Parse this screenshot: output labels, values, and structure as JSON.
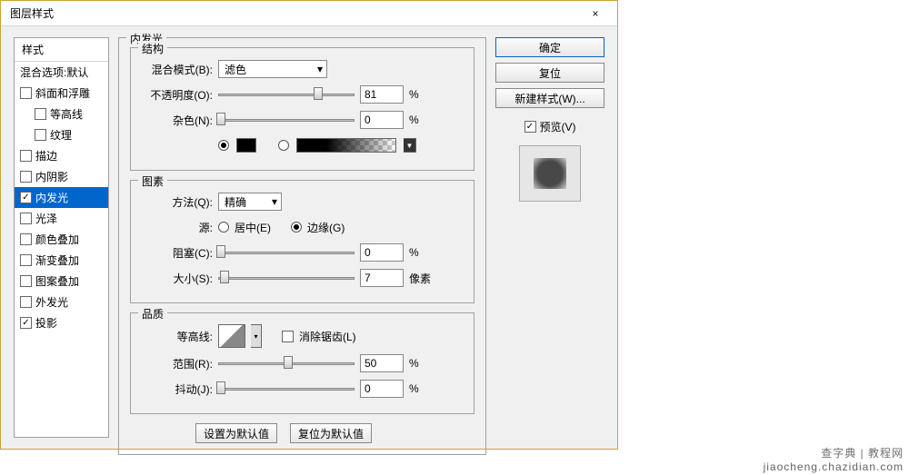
{
  "window": {
    "title": "图层样式",
    "close": "×"
  },
  "sidebar": {
    "header": "样式",
    "blend_options": "混合选项:默认",
    "items": [
      {
        "label": "斜面和浮雕",
        "checked": false,
        "indent": false
      },
      {
        "label": "等高线",
        "checked": false,
        "indent": true
      },
      {
        "label": "纹理",
        "checked": false,
        "indent": true
      },
      {
        "label": "描边",
        "checked": false,
        "indent": false
      },
      {
        "label": "内阴影",
        "checked": false,
        "indent": false
      },
      {
        "label": "内发光",
        "checked": true,
        "indent": false,
        "selected": true
      },
      {
        "label": "光泽",
        "checked": false,
        "indent": false
      },
      {
        "label": "颜色叠加",
        "checked": false,
        "indent": false
      },
      {
        "label": "渐变叠加",
        "checked": false,
        "indent": false
      },
      {
        "label": "图案叠加",
        "checked": false,
        "indent": false
      },
      {
        "label": "外发光",
        "checked": false,
        "indent": false
      },
      {
        "label": "投影",
        "checked": true,
        "indent": false
      }
    ]
  },
  "main": {
    "group_title": "内发光",
    "structure": {
      "title": "结构",
      "blend_mode_label": "混合模式(B):",
      "blend_mode_value": "滤色",
      "opacity_label": "不透明度(O):",
      "opacity_value": "81",
      "opacity_unit": "%",
      "noise_label": "杂色(N):",
      "noise_value": "0",
      "noise_unit": "%"
    },
    "elements": {
      "title": "图素",
      "technique_label": "方法(Q):",
      "technique_value": "精确",
      "source_label": "源:",
      "source_center": "居中(E)",
      "source_edge": "边缘(G)",
      "source_selected": "edge",
      "choke_label": "阻塞(C):",
      "choke_value": "0",
      "choke_unit": "%",
      "size_label": "大小(S):",
      "size_value": "7",
      "size_unit": "像素"
    },
    "quality": {
      "title": "品质",
      "contour_label": "等高线:",
      "antialias_label": "消除锯齿(L)",
      "antialias_checked": false,
      "range_label": "范围(R):",
      "range_value": "50",
      "range_unit": "%",
      "jitter_label": "抖动(J):",
      "jitter_value": "0",
      "jitter_unit": "%"
    },
    "buttons": {
      "make_default": "设置为默认值",
      "reset_default": "复位为默认值"
    }
  },
  "right": {
    "ok": "确定",
    "cancel": "复位",
    "new_style": "新建样式(W)...",
    "preview_label": "预览(V)",
    "preview_checked": true
  },
  "watermark": {
    "line1": "查字典 | 教程网",
    "line2": "jiaocheng.chazidian.com"
  }
}
